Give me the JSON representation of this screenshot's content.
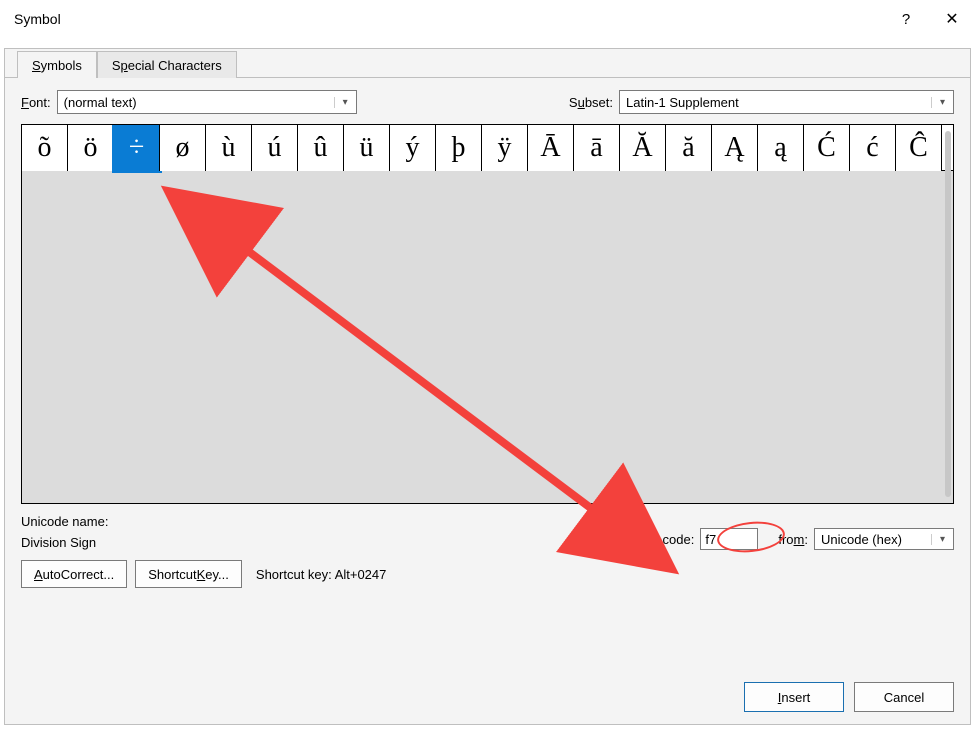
{
  "window": {
    "title": "Symbol",
    "help": "?",
    "close": "✕"
  },
  "tabs": {
    "symbols": "Symbols",
    "special": "Special Characters"
  },
  "fontRow": {
    "fontLabel": "Font:",
    "fontValue": "(normal text)",
    "subsetLabel": "Subset:",
    "subsetValue": "Latin-1 Supplement"
  },
  "symbols": [
    "õ",
    "ö",
    "÷",
    "ø",
    "ù",
    "ú",
    "û",
    "ü",
    "ý",
    "þ",
    "ÿ",
    "Ā",
    "ā",
    "Ă",
    "ă",
    "Ą",
    "ą",
    "Ć",
    "ć",
    "Ĉ"
  ],
  "selectedIndex": 2,
  "unicode": {
    "label": "Unicode name:",
    "name": "Division Sign",
    "charCodeLabel": "Character code:",
    "charCodeValue": "f7",
    "fromLabel": "from:",
    "fromValue": "Unicode (hex)"
  },
  "buttons": {
    "autocorrect": "AutoCorrect...",
    "shortcutKey": "Shortcut Key...",
    "shortcutInfoLabel": "Shortcut key:",
    "shortcutInfoValue": "Alt+0247",
    "insert": "Insert",
    "cancel": "Cancel"
  },
  "annotation": {
    "color": "#f3413c"
  }
}
